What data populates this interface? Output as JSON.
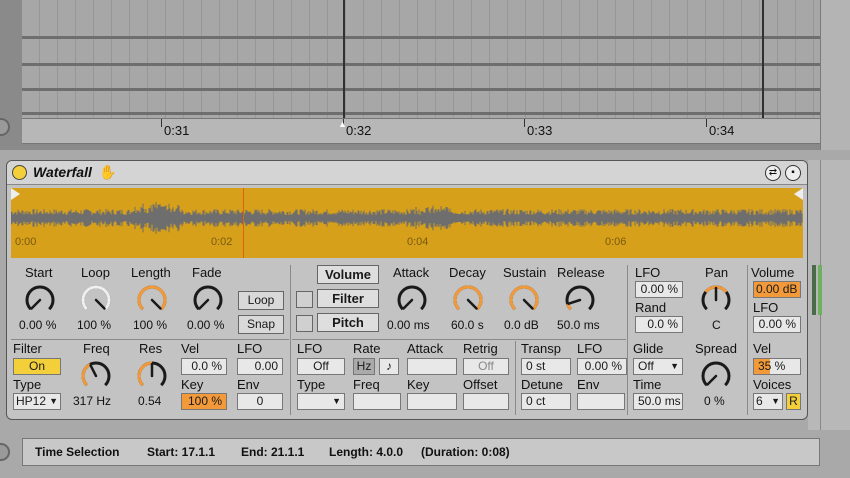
{
  "arrangement": {
    "ticks": [
      "0:31",
      "0:32",
      "0:33",
      "0:34"
    ]
  },
  "device": {
    "title": "Waterfall",
    "wave_labels": [
      "0:00",
      "0:02",
      "0:04",
      "0:06"
    ],
    "sample": {
      "start_label": "Start",
      "start_value": "0.00 %",
      "loop_label": "Loop",
      "loop_value": "100 %",
      "length_label": "Length",
      "length_value": "100 %",
      "fade_label": "Fade",
      "fade_value": "0.00 %",
      "loop_button": "Loop",
      "snap_button": "Snap"
    },
    "filter": {
      "filter_label": "Filter",
      "filter_on": "On",
      "type_label": "Type",
      "type_value": "HP12",
      "freq_label": "Freq",
      "freq_value": "317 Hz",
      "res_label": "Res",
      "res_value": "0.54",
      "vel_label": "Vel",
      "vel_value": "0.0 %",
      "lfo_label": "LFO",
      "lfo_value": "0.00",
      "key_label": "Key",
      "key_value": "100 %",
      "env_label": "Env",
      "env_value": "0"
    },
    "envelope": {
      "volume_button": "Volume",
      "filter_button": "Filter",
      "pitch_button": "Pitch",
      "attack_label": "Attack",
      "attack_value": "0.00 ms",
      "decay_label": "Decay",
      "decay_value": "60.0 s",
      "sustain_label": "Sustain",
      "sustain_value": "0.0 dB",
      "release_label": "Release",
      "release_value": "50.0 ms"
    },
    "lfo": {
      "lfo_label": "LFO",
      "lfo_value": "Off",
      "rate_label": "Rate",
      "rate_hz": "Hz",
      "rate_note": "♪",
      "attack_label": "Attack",
      "retrig_label": "Retrig",
      "retrig_value": "Off",
      "type_label": "Type",
      "freq_label": "Freq",
      "key_label": "Key",
      "offset_label": "Offset"
    },
    "mod": {
      "lfo_label": "LFO",
      "lfo_value": "0.00 %",
      "rand_label": "Rand",
      "rand_value": "0.0 %",
      "pan_label": "Pan",
      "pan_value": "C"
    },
    "pitch": {
      "transp_label": "Transp",
      "transp_value": "0 st",
      "lfo_label": "LFO",
      "lfo_value": "0.00 %",
      "detune_label": "Detune",
      "detune_value": "0 ct",
      "env_label": "Env",
      "glide_label": "Glide",
      "glide_value": "Off",
      "time_label": "Time",
      "time_value": "50.0 ms",
      "spread_label": "Spread",
      "spread_value": "0 %"
    },
    "output": {
      "volume_label": "Volume",
      "volume_value": "0.00 dB",
      "lfo_label": "LFO",
      "lfo_value": "0.00 %",
      "vel_label": "Vel",
      "vel_value": "35 %",
      "voices_label": "Voices",
      "voices_value": "6",
      "r_button": "R"
    }
  },
  "status": {
    "mode": "Time Selection",
    "start": "Start: 17.1.1",
    "end": "End: 21.1.1",
    "length": "Length: 4.0.0",
    "duration": "(Duration: 0:08)"
  },
  "colors": {
    "accent": "#f29a3a",
    "wave": "#d6a01a",
    "power": "#f3d03a"
  }
}
